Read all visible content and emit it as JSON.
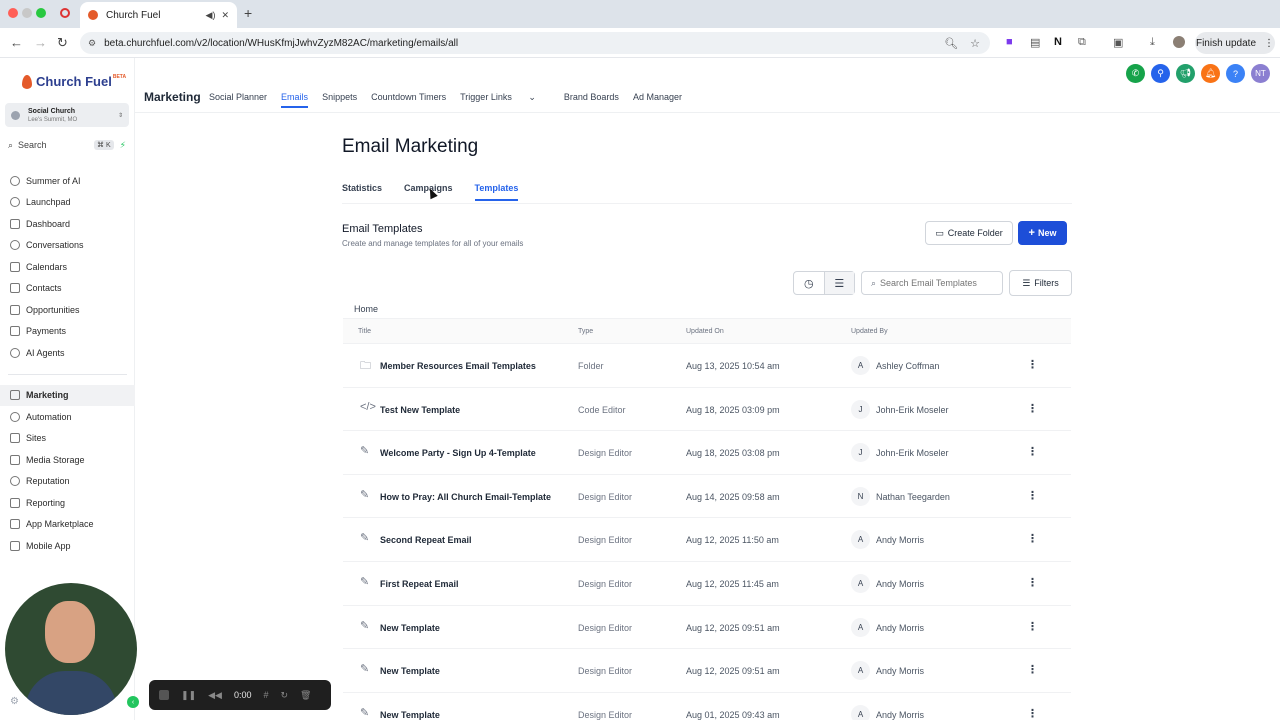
{
  "browser": {
    "tab_title": "Church Fuel",
    "url": "beta.churchfuel.com/v2/location/WHusKfmjJwhvZyzM82AC/marketing/emails/all",
    "finish_update": "Finish update"
  },
  "sidebar": {
    "logo_text": "Church Fuel",
    "logo_badge": "BETA",
    "account_name": "Social Church",
    "account_location": "Lee's Summit, MO",
    "search_label": "Search",
    "search_shortcut": "⌘ K",
    "items": [
      {
        "label": "Summer of AI",
        "icon": "sun-icon"
      },
      {
        "label": "Launchpad",
        "icon": "rocket-icon"
      },
      {
        "label": "Dashboard",
        "icon": "grid-icon"
      },
      {
        "label": "Conversations",
        "icon": "chat-icon"
      },
      {
        "label": "Calendars",
        "icon": "calendar-icon"
      },
      {
        "label": "Contacts",
        "icon": "contacts-icon"
      },
      {
        "label": "Opportunities",
        "icon": "funnel-icon"
      },
      {
        "label": "Payments",
        "icon": "payments-icon"
      },
      {
        "label": "AI Agents",
        "icon": "sparkle-icon"
      }
    ],
    "items2": [
      {
        "label": "Marketing",
        "icon": "send-icon",
        "active": true
      },
      {
        "label": "Automation",
        "icon": "automation-icon"
      },
      {
        "label": "Sites",
        "icon": "sites-icon"
      },
      {
        "label": "Media Storage",
        "icon": "image-icon"
      },
      {
        "label": "Reputation",
        "icon": "star-icon"
      },
      {
        "label": "Reporting",
        "icon": "chart-icon"
      },
      {
        "label": "App Marketplace",
        "icon": "apps-icon"
      },
      {
        "label": "Mobile App",
        "icon": "phone-icon"
      }
    ]
  },
  "recorder": {
    "time": "0:00"
  },
  "topnav": {
    "brand": "Marketing",
    "links": [
      "Social Planner",
      "Emails",
      "Snippets",
      "Countdown Timers",
      "Trigger Links",
      "Brand Boards",
      "Ad Manager"
    ],
    "active_link": "Emails",
    "user_initials": "NT",
    "colors": {
      "phone": "#16a34a",
      "link": "#2563eb",
      "megaphone": "#22a06b",
      "bell": "#f97316",
      "help": "#3b82f6",
      "avatar": "#8b7fd1"
    }
  },
  "main": {
    "title": "Email Marketing",
    "tabs": [
      "Statistics",
      "Campaigns",
      "Templates"
    ],
    "active_tab": "Templates",
    "section_title": "Email Templates",
    "section_subtitle": "Create and manage templates for all of your emails",
    "create_folder": "Create Folder",
    "new_button": "New",
    "search_placeholder": "Search Email Templates",
    "filters": "Filters",
    "breadcrumb": "Home",
    "columns": [
      "Title",
      "Type",
      "Updated On",
      "Updated By"
    ],
    "rows": [
      {
        "icon": "folder-icon",
        "title": "Member Resources Email Templates",
        "type": "Folder",
        "updated_on": "Aug 13, 2025 10:54 am",
        "initial": "A",
        "updated_by": "Ashley Coffman"
      },
      {
        "icon": "code-icon",
        "title": "Test New Template",
        "type": "Code Editor",
        "updated_on": "Aug 18, 2025 03:09 pm",
        "initial": "J",
        "updated_by": "John-Erik Moseler"
      },
      {
        "icon": "pencil-icon",
        "title": "Welcome Party - Sign Up 4-Template",
        "type": "Design Editor",
        "updated_on": "Aug 18, 2025 03:08 pm",
        "initial": "J",
        "updated_by": "John-Erik Moseler"
      },
      {
        "icon": "pencil-icon",
        "title": "How to Pray: All Church Email-Template",
        "type": "Design Editor",
        "updated_on": "Aug 14, 2025 09:58 am",
        "initial": "N",
        "updated_by": "Nathan Teegarden"
      },
      {
        "icon": "pencil-icon",
        "title": "Second Repeat Email",
        "type": "Design Editor",
        "updated_on": "Aug 12, 2025 11:50 am",
        "initial": "A",
        "updated_by": "Andy Morris"
      },
      {
        "icon": "pencil-icon",
        "title": "First Repeat Email",
        "type": "Design Editor",
        "updated_on": "Aug 12, 2025 11:45 am",
        "initial": "A",
        "updated_by": "Andy Morris"
      },
      {
        "icon": "pencil-icon",
        "title": "New Template",
        "type": "Design Editor",
        "updated_on": "Aug 12, 2025 09:51 am",
        "initial": "A",
        "updated_by": "Andy Morris"
      },
      {
        "icon": "pencil-icon",
        "title": "New Template",
        "type": "Design Editor",
        "updated_on": "Aug 12, 2025 09:51 am",
        "initial": "A",
        "updated_by": "Andy Morris"
      },
      {
        "icon": "pencil-icon",
        "title": "New Template",
        "type": "Design Editor",
        "updated_on": "Aug 01, 2025 09:43 am",
        "initial": "A",
        "updated_by": "Andy Morris"
      }
    ]
  }
}
